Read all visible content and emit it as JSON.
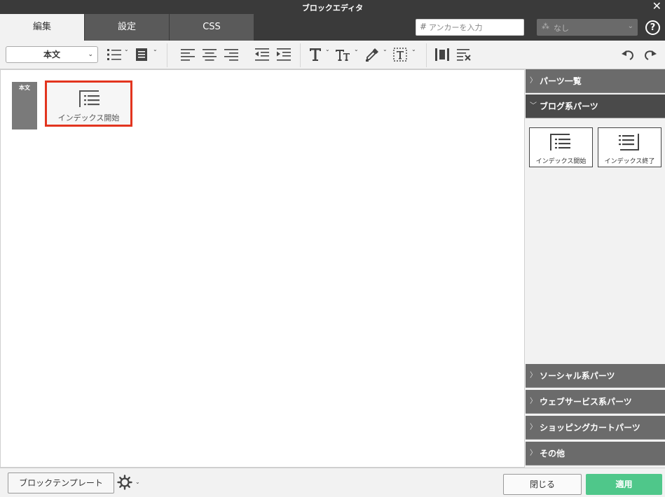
{
  "window": {
    "title": "ブロックエディタ"
  },
  "tabs": [
    {
      "label": "編集"
    },
    {
      "label": "設定"
    },
    {
      "label": "CSS"
    }
  ],
  "anchor": {
    "placeholder": "アンカーを入力"
  },
  "class_select": {
    "value": "なし"
  },
  "toolbar": {
    "style_select": "本文"
  },
  "editor": {
    "body_marker": "本文",
    "blocks": [
      {
        "label": "インデックス開始"
      }
    ]
  },
  "panel": {
    "sections": [
      {
        "label": "パーツ一覧"
      },
      {
        "label": "ブログ系パーツ"
      },
      {
        "label": "ソーシャル系パーツ"
      },
      {
        "label": "ウェブサービス系パーツ"
      },
      {
        "label": "ショッピングカートパーツ"
      },
      {
        "label": "その他"
      }
    ],
    "parts": [
      {
        "label": "インデックス開始"
      },
      {
        "label": "インデックス終了"
      }
    ]
  },
  "bottom": {
    "template_button": "ブロックテンプレート",
    "close_button": "閉じる",
    "apply_button": "適用"
  },
  "colors": {
    "apply": "#4fc78a",
    "highlight": "#e2351f",
    "chrome": "#3a3a3a",
    "section": "#6b6b6b"
  }
}
